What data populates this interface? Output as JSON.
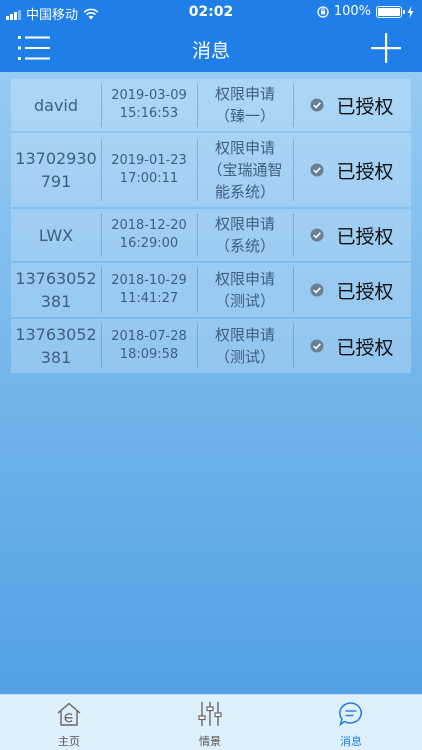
{
  "status_bar": {
    "carrier": "中国移动",
    "time": "02:02",
    "battery": "100%"
  },
  "header": {
    "title": "消息",
    "menu_icon": "menu-icon",
    "add_icon": "plus-icon"
  },
  "messages": [
    {
      "user": "david",
      "date": "2019-03-09",
      "time": "15:16:53",
      "type": "权限申请（臻一）",
      "status": "已授权"
    },
    {
      "user": "13702930791",
      "date": "2019-01-23",
      "time": "17:00:11",
      "type": "权限申请（宝瑞通智能系统）",
      "status": "已授权"
    },
    {
      "user": "LWX",
      "date": "2018-12-20",
      "time": "16:29:00",
      "type": "权限申请（系统）",
      "status": "已授权"
    },
    {
      "user": "13763052381",
      "date": "2018-10-29",
      "time": "11:41:27",
      "type": "权限申请（测试）",
      "status": "已授权"
    },
    {
      "user": "13763052381",
      "date": "2018-07-28",
      "time": "18:09:58",
      "type": "权限申请（测试）",
      "status": "已授权"
    }
  ],
  "tabs": [
    {
      "label": "主页",
      "icon": "home-icon",
      "active": false
    },
    {
      "label": "情景",
      "icon": "sliders-icon",
      "active": false
    },
    {
      "label": "消息",
      "icon": "chat-icon",
      "active": true
    }
  ],
  "colors": {
    "primary": "#1f7ee8",
    "tab_active": "#1f7ee8",
    "tab_inactive": "#555555",
    "check": "#6b7f92"
  }
}
